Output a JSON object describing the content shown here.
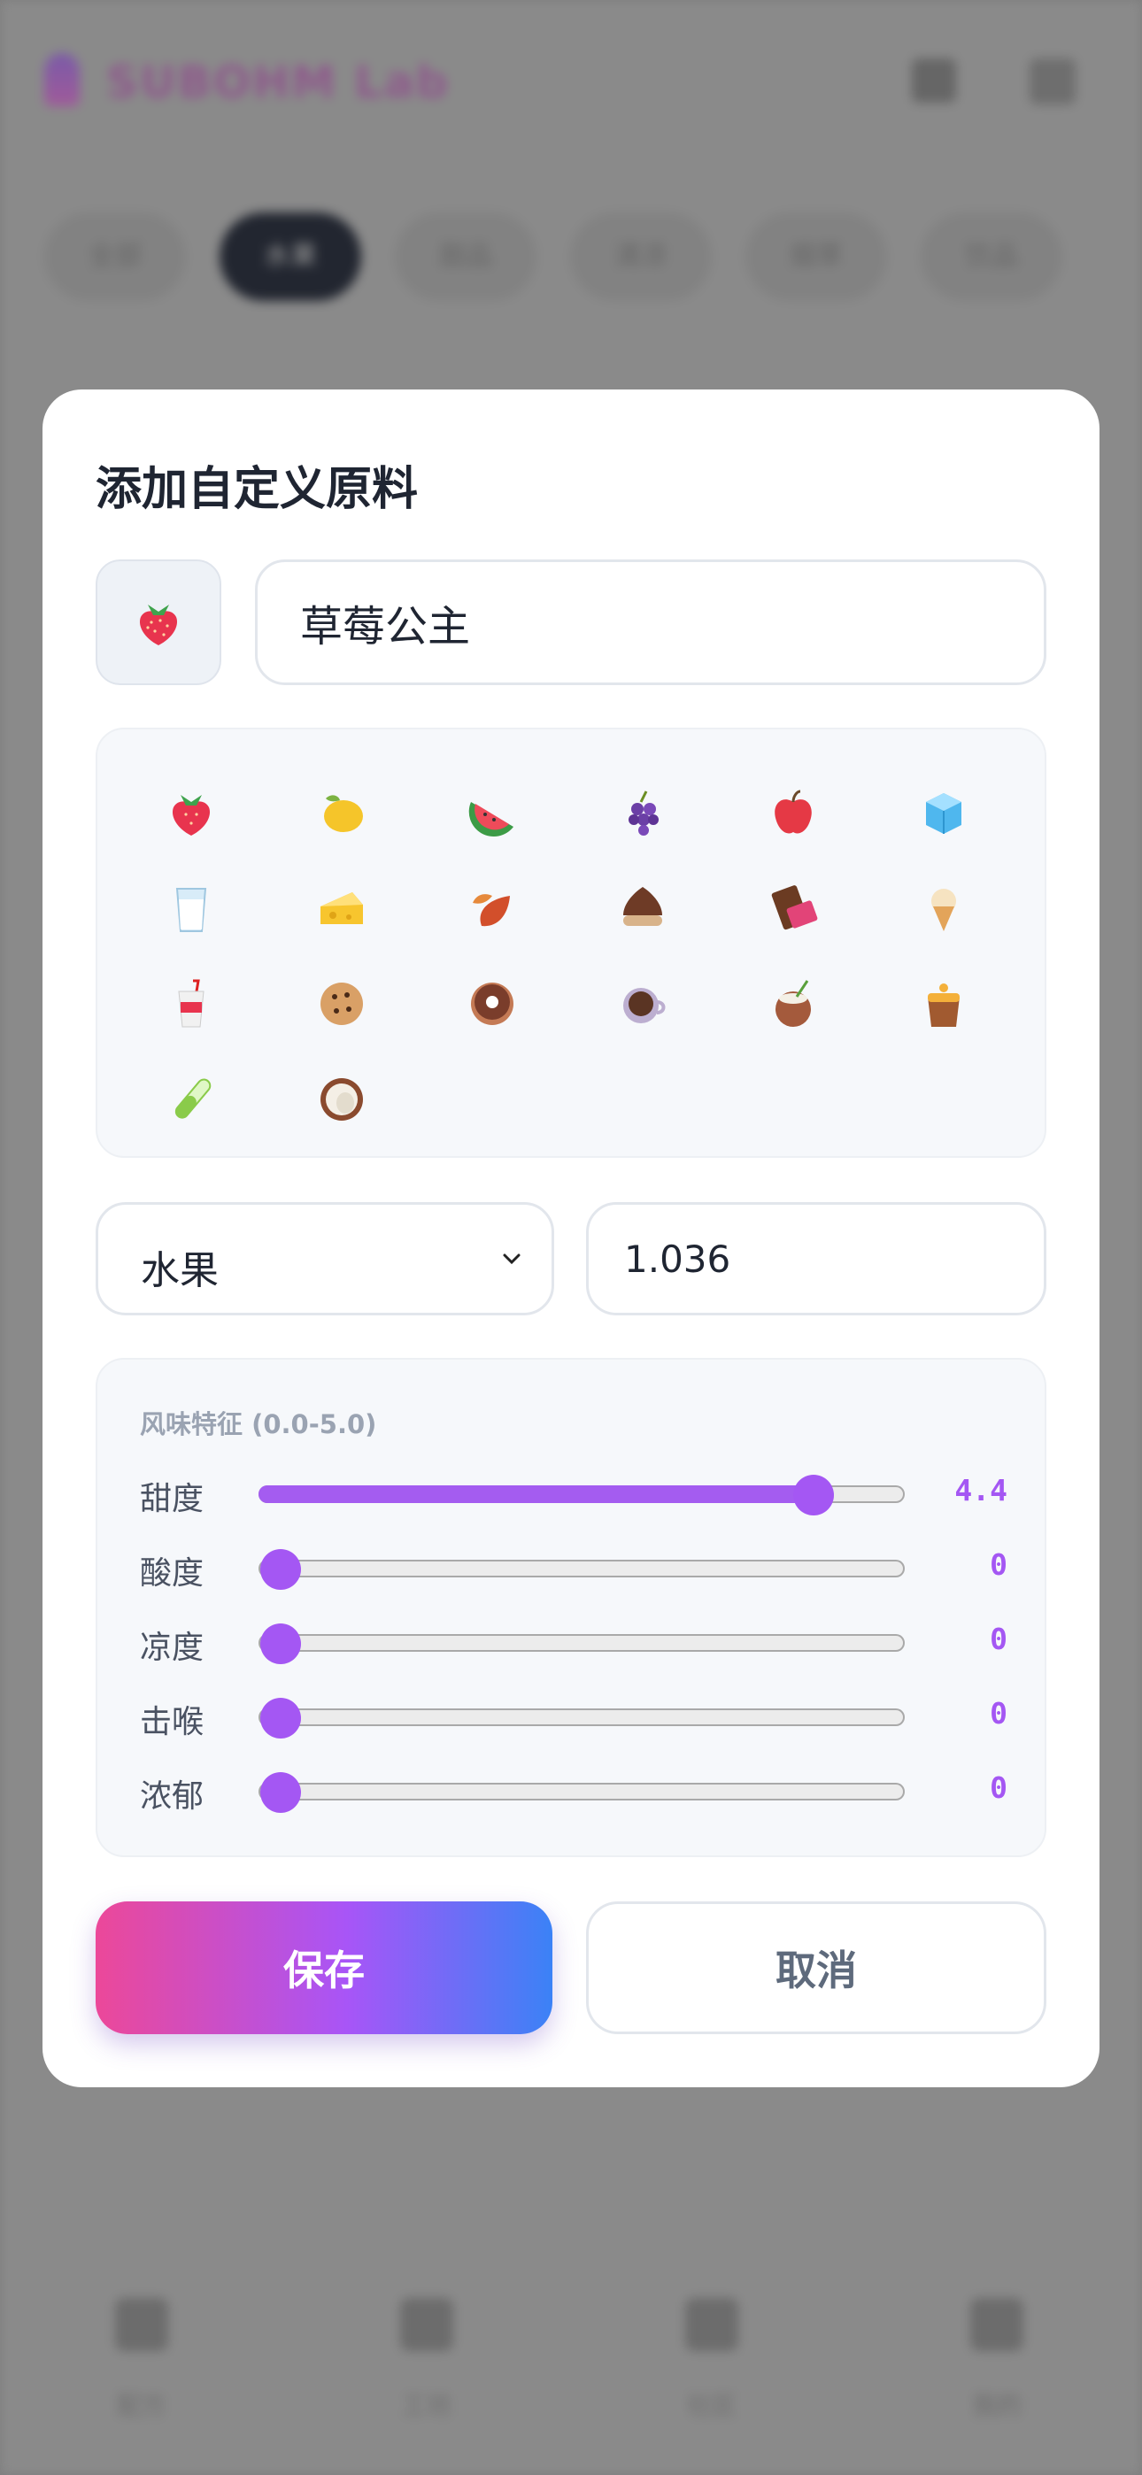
{
  "background": {
    "app_title": "SUBOHM Lab",
    "category_chips": [
      "全部",
      "水果",
      "甜品",
      "清凉",
      "烟草",
      "饮品"
    ],
    "active_chip_index": 1,
    "bottom_tabs": [
      "配方",
      "工坊",
      "社区",
      "我的"
    ]
  },
  "modal": {
    "title": "添加自定义原料",
    "selected_icon": "strawberry-icon",
    "name_value": "草莓公主",
    "icons": [
      "strawberry-icon",
      "lemon-icon",
      "watermelon-icon",
      "grapes-icon",
      "apple-icon",
      "ice-cube-icon",
      "milk-glass-icon",
      "cheese-icon",
      "leaves-icon",
      "chestnut-icon",
      "chocolate-bar-icon",
      "ice-cream-icon",
      "soda-cup-icon",
      "cookie-icon",
      "donut-icon",
      "coffee-cup-icon",
      "coconut-drink-icon",
      "pudding-icon",
      "test-tube-icon",
      "coconut-icon"
    ],
    "category_value": "水果",
    "ratio_value": "1.036",
    "flavor": {
      "title": "风味特征 (0.0-5.0)",
      "max": 5,
      "rows": [
        {
          "label": "甜度",
          "value": 4.4,
          "display": "4.4"
        },
        {
          "label": "酸度",
          "value": 0,
          "display": "0"
        },
        {
          "label": "凉度",
          "value": 0,
          "display": "0"
        },
        {
          "label": "击喉",
          "value": 0,
          "display": "0"
        },
        {
          "label": "浓郁",
          "value": 0,
          "display": "0"
        }
      ]
    },
    "save_label": "保存",
    "cancel_label": "取消"
  },
  "colors": {
    "accent": "#a457f3",
    "save_gradient": [
      "#ec4899",
      "#a855f7",
      "#3b82f6"
    ],
    "overlay": "#7d7d7d"
  }
}
